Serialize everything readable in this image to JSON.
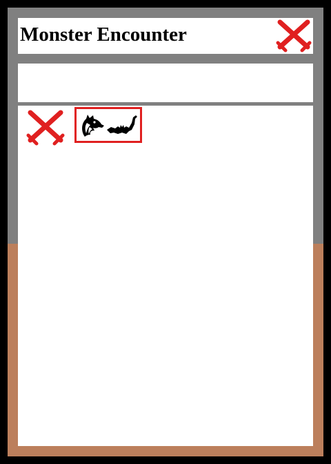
{
  "card": {
    "title": "Monster Encounter",
    "subtitle": ""
  },
  "colors": {
    "frame_top": "#808080",
    "frame_bottom": "#bc7f5c",
    "panel": "#ffffff",
    "accent": "#e02020",
    "icon": "#000000"
  },
  "icons": {
    "header_action": "crossed-swords-icon",
    "remove_action": "crossed-swords-icon",
    "monsters": [
      "wolf-head-icon",
      "bat-icon"
    ]
  }
}
